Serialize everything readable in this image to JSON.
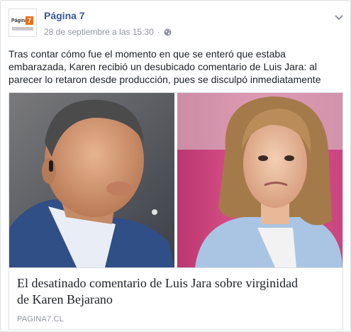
{
  "post": {
    "page_name": "Página 7",
    "timestamp": "28 de septiembre a las 15:30",
    "separator": "·",
    "privacy_icon": "globe-icon",
    "menu_icon": "chevron-down-icon",
    "avatar_text": "Página",
    "avatar_badge": "7",
    "text_lines": [
      "Tras contar cómo fue el momento en que se enteró que estaba",
      "embarazada, Karen recibió un desubicado comentario de Luis Jara: al",
      "parecer lo retaron desde producción, pues se disculpó inmediatamente"
    ]
  },
  "link": {
    "title_lines": [
      "El desatinado comentario de Luis Jara sobre virginidad",
      "de Karen Bejarano"
    ],
    "domain": "PAGINA7.CL"
  },
  "colors": {
    "brand_link": "#365899",
    "meta_gray": "#90949c",
    "text": "#1d2129",
    "border": "#dddfe2",
    "logo_orange": "#e8701a"
  }
}
